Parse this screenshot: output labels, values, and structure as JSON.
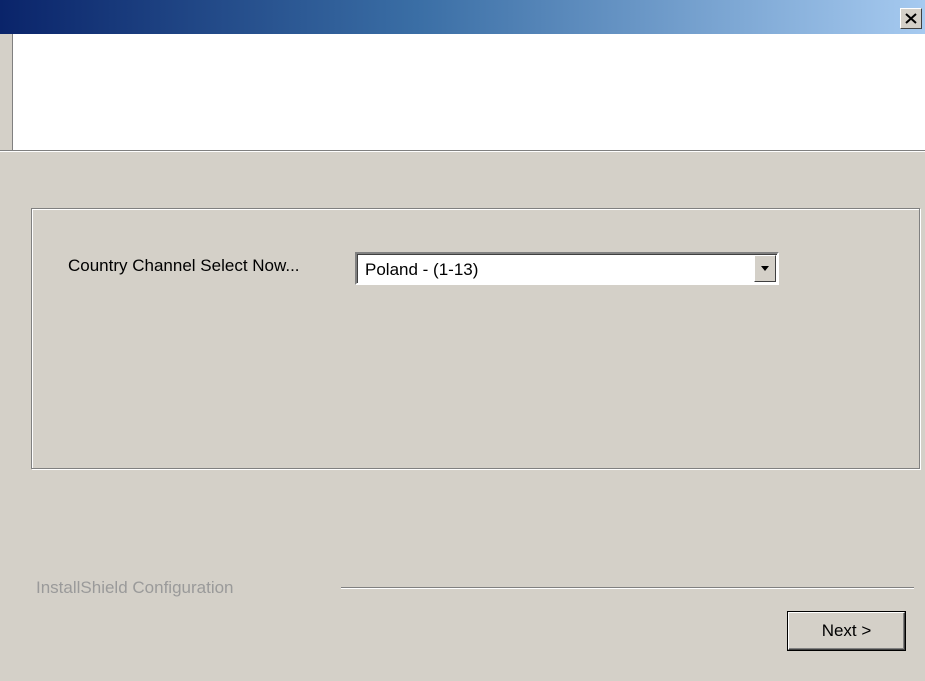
{
  "window": {
    "title": "",
    "close_icon": "close-x-icon"
  },
  "form": {
    "country_label": "Country Channel Select Now...",
    "country_selected": "Poland - (1-13)",
    "dropdown_icon": "dropdown-arrow-icon"
  },
  "footer": {
    "brand": "InstallShield Configuration",
    "next_label": "Next >"
  },
  "colors": {
    "titlebar_start": "#0a246a",
    "titlebar_end": "#a6caf0",
    "dialog_bg": "#d4d0c8",
    "header_bg": "#ffffff",
    "brand_text": "#9a9a9a"
  }
}
